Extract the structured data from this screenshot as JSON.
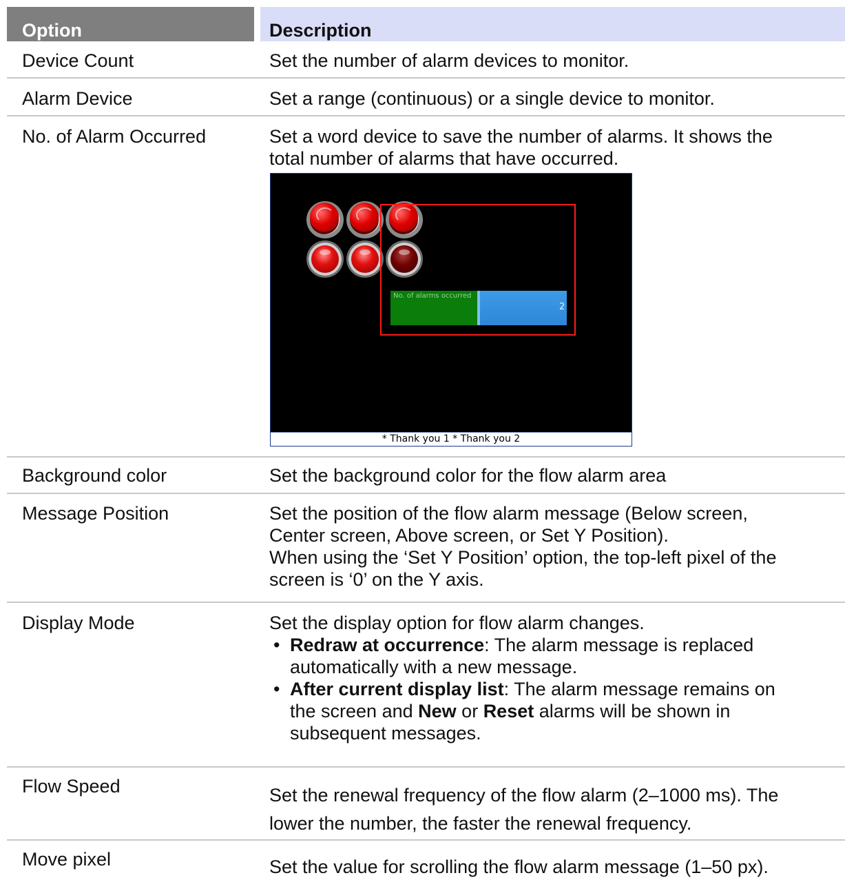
{
  "table": {
    "header": {
      "option": "Option",
      "description": "Description"
    },
    "rows": {
      "device_count": {
        "option": "Device Count",
        "description": "Set the number of alarm devices to monitor."
      },
      "alarm_device": {
        "option": "Alarm Device",
        "description": "Set a range (continuous) or a single device to monitor."
      },
      "no_alarm": {
        "option": "No. of Alarm Occurred",
        "description_line1": "Set a word device to save the number of alarms. It shows the",
        "description_line2": "total number of alarms that have occurred."
      },
      "background_color": {
        "option": "Background color",
        "description": "Set the background color for the flow alarm area"
      },
      "message_position": {
        "option": "Message Position",
        "line1": "Set the position of the flow alarm message (Below screen,",
        "line2": "Center screen, Above screen, or Set Y Position).",
        "line3": "When using the ‘Set Y Position’ option, the top-left pixel of the",
        "line4": "screen is ‘0’ on the Y axis."
      },
      "display_mode": {
        "option": "Display Mode",
        "intro": "Set the display option for flow alarm changes.",
        "bullet1_bold": "Redraw at occurrence",
        "bullet1_rest_line1": ": The alarm message is replaced",
        "bullet1_line2": "automatically with a new message.",
        "bullet2_bold": "After current display list",
        "bullet2_rest_line1": ": The alarm message remains on",
        "bullet2_line2_a": "the screen and ",
        "bullet2_new": "New",
        "bullet2_or": " or ",
        "bullet2_reset": "Reset",
        "bullet2_line2_b": " alarms will be shown in",
        "bullet2_line3": "subsequent messages."
      },
      "flow_speed": {
        "option": "Flow Speed",
        "line1": "Set the renewal frequency of the flow alarm (2–1000 ms). The",
        "line2": "lower the number, the faster the renewal frequency."
      },
      "move_pixel": {
        "option": "Move pixel",
        "description": "Set the value for scrolling the flow alarm message (1–50 px)."
      }
    }
  },
  "example_screen": {
    "field_label": "No. of alarms occurred",
    "field_value": "2",
    "footer_text": "* Thank you 1 * Thank you 2",
    "lamp_states": [
      "on",
      "on",
      "off"
    ]
  }
}
